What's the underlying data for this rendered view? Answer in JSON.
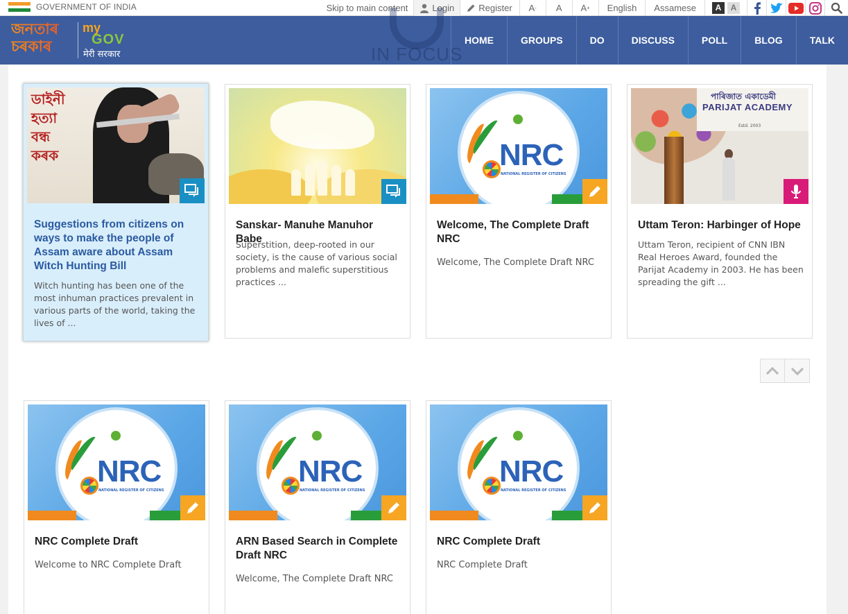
{
  "topbar": {
    "gov_label": "GOVERNMENT OF INDIA",
    "skip_link": "Skip to main content",
    "login": "Login",
    "register": "Register",
    "font_decrease": "A",
    "font_decrease_sup": "-",
    "font_normal": "A",
    "font_increase": "A",
    "font_increase_sup": "+",
    "lang_english": "English",
    "lang_assamese": "Assamese",
    "contrast_dark": "A",
    "contrast_light": "A"
  },
  "header": {
    "logo_assam": "জনতাৰ চৰকাৰ",
    "logo_my": "my",
    "logo_gov": "GOV",
    "logo_meri": "मेरी सरकार",
    "in_focus": "IN FOCUS",
    "menu": [
      "HOME",
      "GROUPS",
      "DO",
      "DISCUSS",
      "POLL",
      "BLOG",
      "TALK"
    ]
  },
  "cards": [
    {
      "title": "Suggestions from citizens on ways to make the people of Assam aware about Assam Witch Hunting Bill",
      "desc": "Witch hunting has been one of the most inhuman practices prevalent in various parts of the world, taking the lives of ...",
      "type": "discuss",
      "image_text": "ডাইনী হত্যা বন্ধ কৰক"
    },
    {
      "title": "Sanskar- Manuhe Manuhor Babe",
      "desc": "Superstition, deep-rooted in our society, is the cause of various social problems and malefic superstitious practices ...",
      "type": "discuss"
    },
    {
      "title": "Welcome, The Complete Draft NRC",
      "desc": "Welcome, The Complete Draft NRC",
      "type": "do"
    },
    {
      "title": "Uttam Teron: Harbinger of Hope",
      "desc": "Uttam Teron, recipient of CNN IBN Real Heroes Award, founded the Parijat Academy in 2003. He has been spreading the gift ...",
      "type": "talk",
      "image_sign_title": "PARIJAT ACADEMY",
      "image_sign_assamese": "পাৰিজাত একাডেমী",
      "image_sign_estd": "Estd. 2003"
    },
    {
      "title": "NRC Complete Draft",
      "desc": "Welcome to NRC Complete Draft",
      "type": "do"
    },
    {
      "title": "ARN Based Search in Complete Draft NRC",
      "desc": "Welcome, The Complete Draft NRC",
      "type": "do"
    },
    {
      "title": "NRC Complete Draft",
      "desc": "NRC Complete Draft",
      "type": "do"
    }
  ],
  "nrc_logo": {
    "text": "NRC",
    "sub": "NATIONAL REGISTER OF CITIZENS"
  },
  "colors": {
    "nav_bg": "#3d5d9e",
    "discuss_badge": "#1a8fc4",
    "do_badge": "#f6a623",
    "talk_badge": "#d81b78",
    "active_card_bg": "#d9eefb",
    "active_title": "#2a5aa0"
  }
}
